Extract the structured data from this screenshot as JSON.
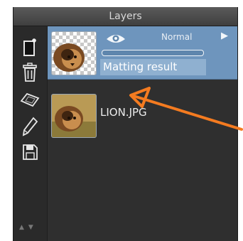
{
  "panel": {
    "title": "Layers"
  },
  "tools": [
    {
      "name": "new-layer-icon"
    },
    {
      "name": "trash-icon"
    },
    {
      "name": "tablet-icon"
    },
    {
      "name": "pencil-icon"
    },
    {
      "name": "save-icon"
    }
  ],
  "layers": [
    {
      "name": "Matting result",
      "blend_mode": "Normal",
      "visible": true,
      "selected": true,
      "opacity": 1.0,
      "thumbnail": "lion-cutout-on-transparency"
    },
    {
      "name": "LION.JPG",
      "selected": false,
      "thumbnail": "lion-photo"
    }
  ],
  "colors": {
    "panel_bg": "#2f2f2f",
    "selected_row": "#6e95bd",
    "arrow": "#f47b20"
  }
}
